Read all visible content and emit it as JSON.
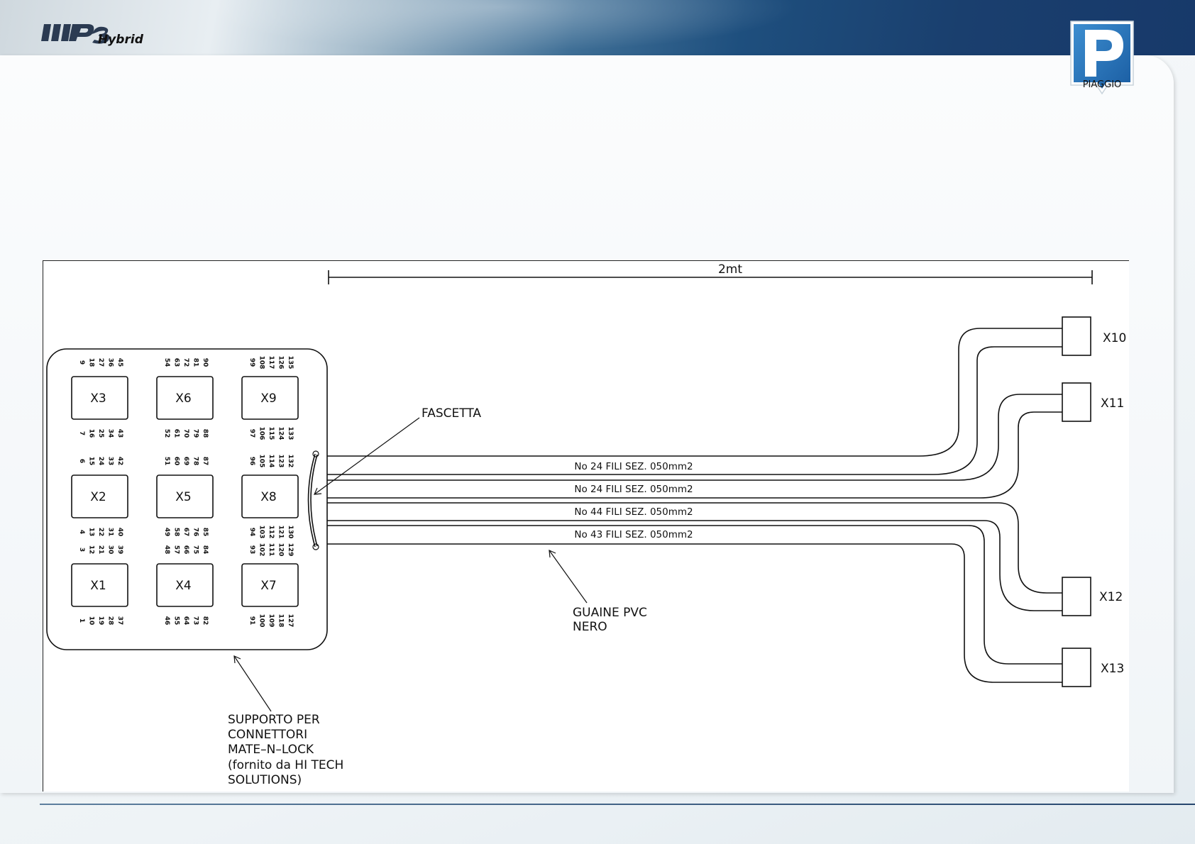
{
  "header": {
    "brand_logo": "MP3 Hybrid",
    "brand_logo_text": "Hybrid",
    "company_logo": "PIAGGIO",
    "company_logo_text": "PIAGGIO"
  },
  "diagram": {
    "length_label": "2mt",
    "connectors": [
      {
        "id": "X3",
        "top_pins": [
          "9",
          "18",
          "27",
          "36",
          "45"
        ],
        "bottom_pins": [
          "7",
          "16",
          "25",
          "34",
          "43"
        ]
      },
      {
        "id": "X6",
        "top_pins": [
          "54",
          "63",
          "72",
          "81",
          "90"
        ],
        "bottom_pins": [
          "52",
          "61",
          "70",
          "79",
          "88"
        ]
      },
      {
        "id": "X9",
        "top_pins": [
          "99",
          "108",
          "117",
          "126",
          "135"
        ],
        "bottom_pins": [
          "97",
          "106",
          "115",
          "124",
          "133"
        ]
      },
      {
        "id": "X2",
        "top_pins": [
          "6",
          "15",
          "24",
          "33",
          "42"
        ],
        "bottom_pins": [
          "4",
          "13",
          "22",
          "31",
          "40"
        ]
      },
      {
        "id": "X5",
        "top_pins": [
          "51",
          "60",
          "69",
          "78",
          "87"
        ],
        "bottom_pins": [
          "49",
          "58",
          "67",
          "76",
          "85"
        ]
      },
      {
        "id": "X8",
        "top_pins": [
          "96",
          "105",
          "114",
          "123",
          "132"
        ],
        "bottom_pins": [
          "94",
          "103",
          "112",
          "121",
          "130"
        ]
      },
      {
        "id": "X1",
        "top_pins": [
          "3",
          "12",
          "21",
          "30",
          "39"
        ],
        "bottom_pins": [
          "1",
          "10",
          "19",
          "28",
          "37"
        ]
      },
      {
        "id": "X4",
        "top_pins": [
          "48",
          "57",
          "66",
          "75",
          "84"
        ],
        "bottom_pins": [
          "46",
          "55",
          "64",
          "73",
          "82"
        ]
      },
      {
        "id": "X7",
        "top_pins": [
          "93",
          "102",
          "111",
          "120",
          "129"
        ],
        "bottom_pins": [
          "91",
          "100",
          "109",
          "118",
          "127"
        ]
      }
    ],
    "fascetta_label": "FASCETTA",
    "cables": [
      "No 24 FILI SEZ. 050mm2",
      "No 24 FILI SEZ. 050mm2",
      "No 44 FILI SEZ. 050mm2",
      "No 43 FILI SEZ. 050mm2"
    ],
    "end_connectors": [
      "X10",
      "X11",
      "X12",
      "X13"
    ],
    "sheath_label_lines": [
      "GUAINE PVC",
      "NERO"
    ],
    "support_label_lines": [
      "SUPPORTO PER",
      "CONNETTORI",
      "MATE–N–LOCK",
      "(fornito da HI TECH",
      "SOLUTIONS)"
    ]
  }
}
